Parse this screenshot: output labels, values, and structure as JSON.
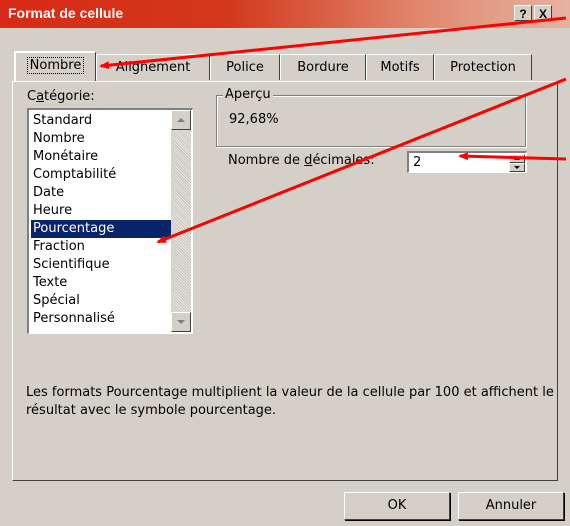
{
  "window": {
    "title": "Format de cellule",
    "help_label": "?",
    "close_label": "X"
  },
  "tabs": [
    {
      "label": "Nombre",
      "active": true
    },
    {
      "label": "Alignement",
      "active": false
    },
    {
      "label": "Police",
      "active": false
    },
    {
      "label": "Bordure",
      "active": false
    },
    {
      "label": "Motifs",
      "active": false
    },
    {
      "label": "Protection",
      "active": false
    }
  ],
  "category": {
    "label_prefix": "C",
    "label_underlined": "a",
    "label_suffix": "tégorie:",
    "items": [
      "Standard",
      "Nombre",
      "Monétaire",
      "Comptabilité",
      "Date",
      "Heure",
      "Pourcentage",
      "Fraction",
      "Scientifique",
      "Texte",
      "Spécial",
      "Personnalisé"
    ],
    "selected": "Pourcentage"
  },
  "preview": {
    "title": "Aperçu",
    "value": "92,68%"
  },
  "decimals": {
    "label_prefix": "Nombre de ",
    "label_underlined": "d",
    "label_suffix": "écimales:",
    "value": "2"
  },
  "description": "Les formats Pourcentage multiplient la valeur de la cellule par 100 et affichent le résultat avec le symbole pourcentage.",
  "buttons": {
    "ok": "OK",
    "cancel": "Annuler"
  },
  "colors": {
    "annotation_arrow": "#ff0000",
    "selection": "#0a246a",
    "dialog_bg": "#d4d0c8"
  }
}
